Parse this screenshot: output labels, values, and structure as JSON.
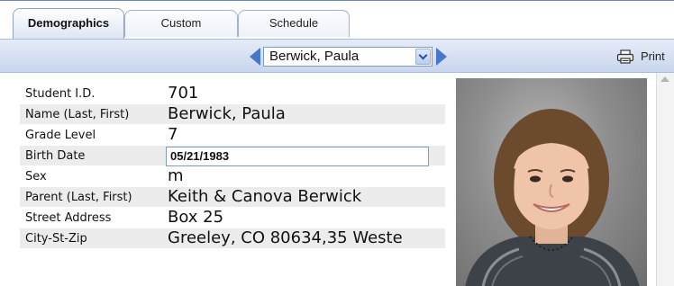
{
  "tabs": [
    {
      "label": "Demographics",
      "active": true
    },
    {
      "label": "Custom",
      "active": false
    },
    {
      "label": "Schedule",
      "active": false
    }
  ],
  "navigation": {
    "selected_student": "Berwick, Paula",
    "print_label": "Print"
  },
  "fields": [
    {
      "label": "Student I.D.",
      "value": "701"
    },
    {
      "label": "Name (Last, First)",
      "value": "Berwick, Paula"
    },
    {
      "label": "Grade Level",
      "value": "7"
    },
    {
      "label": "Birth Date",
      "value": "05/21/1983",
      "editable": true
    },
    {
      "label": "Sex",
      "value": "m"
    },
    {
      "label": "Parent (Last, First)",
      "value": "Keith & Canova Berwick"
    },
    {
      "label": "Street Address",
      "value": "Box 25"
    },
    {
      "label": "City-St-Zip",
      "value": "Greeley, CO  80634,35 Weste"
    }
  ],
  "colors": {
    "accent": "#4a76c9",
    "nav_background": "#c8d6ee",
    "row_shade": "#ececec"
  },
  "icons": {
    "prev": "triangle-left-icon",
    "next": "triangle-right-icon",
    "print": "printer-icon"
  }
}
